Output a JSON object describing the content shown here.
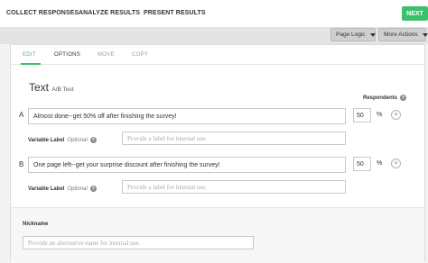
{
  "steps": {
    "collect": "COLLECT RESPONSES",
    "analyze": "ANALYZE RESULTS",
    "present": "PRESENT RESULTS",
    "separator": "→"
  },
  "next_label": "NEXT",
  "toolbar": {
    "page_logic": "Page Logic",
    "more_actions": "More Actions"
  },
  "tabs": {
    "edit": "EDIT",
    "options": "OPTIONS",
    "move": "MOVE",
    "copy": "COPY"
  },
  "question": {
    "type": "Text",
    "subtype": "A/B Test",
    "respondents_label": "Respondents",
    "help_glyph": "?",
    "variant_a": {
      "letter": "A",
      "text": "Almost done--get 50% off after finishing the survey!",
      "percent": "50",
      "pct_sign": "%"
    },
    "variant_b": {
      "letter": "B",
      "text": "One page left--get your surprise discount after finishing the survey!",
      "percent": "50",
      "pct_sign": "%"
    },
    "variable_label": "Variable Label",
    "optional": "Optional",
    "variable_placeholder": "Provide a label for internal use.",
    "plus_glyph": "+"
  },
  "nickname": {
    "label": "Nickname",
    "placeholder": "Provide an alternative name for internal use."
  },
  "colors": {
    "accent": "#3dc06b"
  }
}
